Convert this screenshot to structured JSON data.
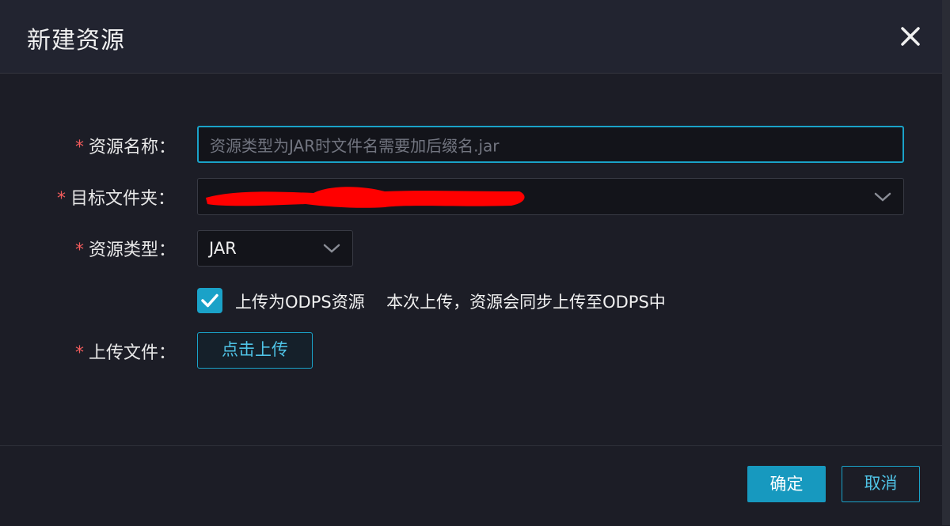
{
  "dialog": {
    "title": "新建资源",
    "close_icon": "close-icon"
  },
  "form": {
    "required_mark": "*",
    "resource_name": {
      "label": "资源名称：",
      "placeholder": "资源类型为JAR时文件名需要加后缀名.jar"
    },
    "target_folder": {
      "label": "目标文件夹：",
      "value_redacted": true
    },
    "resource_type": {
      "label": "资源类型：",
      "value": "JAR"
    },
    "upload_odps": {
      "checked": true,
      "label": "上传为ODPS资源",
      "hint": "本次上传，资源会同步上传至ODPS中"
    },
    "upload_file": {
      "label": "上传文件：",
      "button_label": "点击上传"
    }
  },
  "footer": {
    "ok_label": "确定",
    "cancel_label": "取消"
  },
  "colors": {
    "accent": "#1aa2c8",
    "required": "#f25c5c",
    "background": "#1c1d26"
  }
}
